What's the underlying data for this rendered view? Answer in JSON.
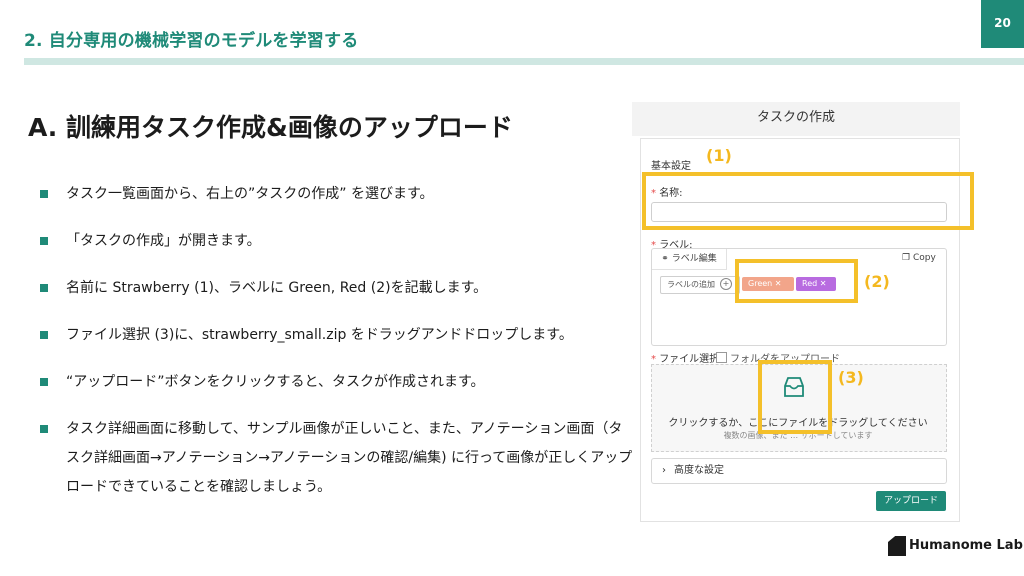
{
  "header": {
    "section_title": "2. 自分専用の機械学習のモデルを学習する",
    "page_number": "20"
  },
  "main_title": "A. 訓練用タスク作成&画像のアップロード",
  "bullets": [
    "タスク一覧画面から、右上の”タスクの作成” を選びます。",
    "「タスクの作成」が開きます。",
    "名前に Strawberry (1)、ラベルに Green, Red (2)を記載します。",
    "ファイル選択 (3)に、strawberry_small.zip をドラッグアンドドロップします。",
    "“アップロード”ボタンをクリックすると、タスクが作成されます。",
    "タスク詳細画面に移動して、サンプル画像が正しいこと、また、アノテーション画面（タスク詳細画面→アノテーション→アノテーションの確認/編集) に行って画像が正しくアップロードできていることを確認しましょう。"
  ],
  "dialog": {
    "title": "タスクの作成",
    "basic_settings": "基本設定",
    "name_label": "名称:",
    "label_label": "ラベル:",
    "label_edit_tab": "ラベル編集",
    "copy": "Copy",
    "add_label": "ラベルの追加",
    "tags": [
      "Green ✕",
      "Red ✕"
    ],
    "file_select_label": "ファイル選択:",
    "folder_upload": "フォルダをアップロード",
    "drop_main": "クリックするか、ここにファイルをドラッグしてください",
    "drop_sub": "複数の画像、また … サポートしています",
    "advanced": "高度な設定",
    "upload_button": "アップロード"
  },
  "annotations": [
    "(1)",
    "(2)",
    "(3)"
  ],
  "colors": {
    "accent": "#1f8a78",
    "highlight": "#f4c02a"
  },
  "logo": "Humanome Lab"
}
